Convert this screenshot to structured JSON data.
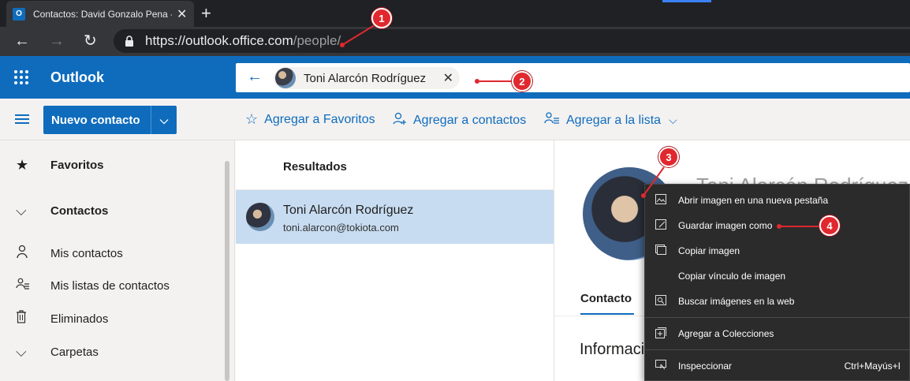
{
  "browser": {
    "tab_title": "Contactos: David Gonzalo Pena -",
    "tab_favicon": "O",
    "url_host": "https://outlook.office.com",
    "url_path": "/people/"
  },
  "outlook": {
    "brand": "Outlook",
    "search_chip_name": "Toni Alarcón Rodríguez"
  },
  "toolbar": {
    "new_contact": "Nuevo contacto",
    "add_favorites": "Agregar a Favoritos",
    "add_contacts": "Agregar a contactos",
    "add_list": "Agregar a la lista"
  },
  "sidebar": {
    "items": [
      {
        "label": "Favoritos",
        "icon": "star-icon"
      },
      {
        "label": "Contactos",
        "icon": "chevron-down-icon"
      },
      {
        "label": "Mis contactos",
        "icon": "person-icon"
      },
      {
        "label": "Mis listas de contactos",
        "icon": "people-list-icon"
      },
      {
        "label": "Eliminados",
        "icon": "trash-icon"
      },
      {
        "label": "Carpetas",
        "icon": "chevron-down-icon"
      }
    ]
  },
  "results": {
    "header": "Resultados",
    "items": [
      {
        "name": "Toni Alarcón Rodríguez",
        "email": "toni.alarcon@tokiota.com"
      }
    ]
  },
  "detail": {
    "name": "Toni Alarcón Rodríguez",
    "tab": "Contacto",
    "section": "Información"
  },
  "context_menu": {
    "items": [
      {
        "label": "Abrir imagen en una nueva pestaña",
        "icon": "open-image-icon"
      },
      {
        "label": "Guardar imagen como",
        "icon": "save-image-icon"
      },
      {
        "label": "Copiar imagen",
        "icon": "copy-image-icon"
      },
      {
        "label": "Copiar vínculo de imagen",
        "icon": ""
      },
      {
        "label": "Buscar imágenes en la web",
        "icon": "search-image-icon"
      },
      {
        "label": "Agregar a Colecciones",
        "icon": "collections-icon"
      },
      {
        "label": "Inspeccionar",
        "icon": "inspect-icon",
        "shortcut": "Ctrl+Mayús+I"
      }
    ]
  },
  "annotations": [
    "1",
    "2",
    "3",
    "4"
  ],
  "colors": {
    "accent": "#0f6cbd",
    "selected_row": "#c7dcf1",
    "annotation": "#e0282e"
  }
}
